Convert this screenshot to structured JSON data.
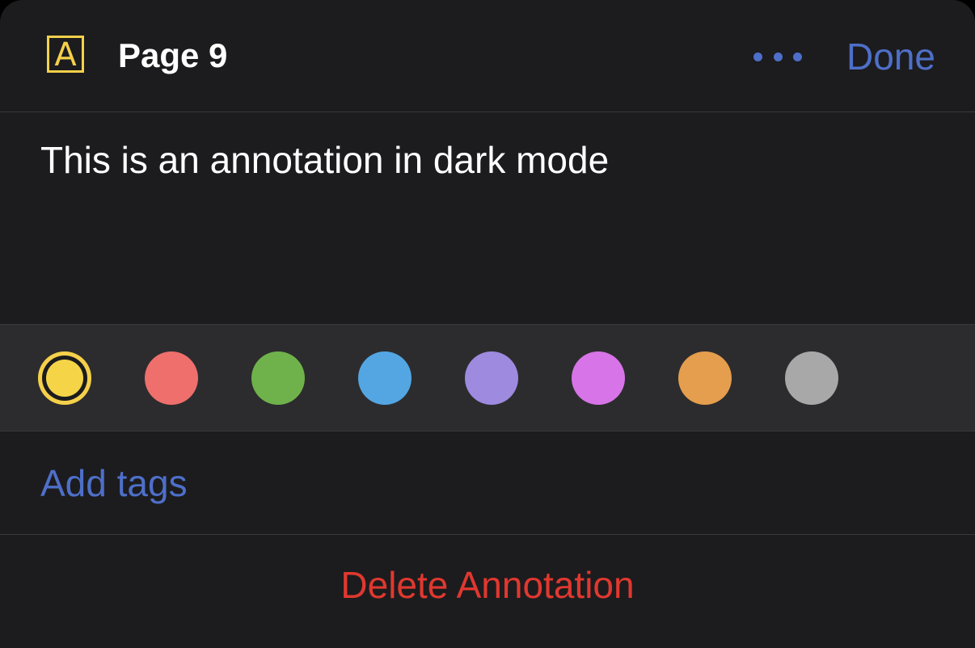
{
  "header": {
    "type_icon_letter": "A",
    "title": "Page 9",
    "more_icon": "ellipsis-icon",
    "done_label": "Done"
  },
  "note": {
    "text": "This is an annotation in dark mode"
  },
  "colors": {
    "selected_index": 0,
    "swatches": [
      "#f5d547",
      "#ee6f6c",
      "#6fb24b",
      "#53a6e2",
      "#9e8adf",
      "#d774e7",
      "#e59e4d",
      "#a8a8a8"
    ]
  },
  "tags": {
    "add_label": "Add tags"
  },
  "actions": {
    "delete_label": "Delete Annotation"
  },
  "theme": {
    "accent": "#4e6fc9",
    "destructive": "#e0382f",
    "highlight": "#f5d04a",
    "background": "#1c1c1e"
  }
}
